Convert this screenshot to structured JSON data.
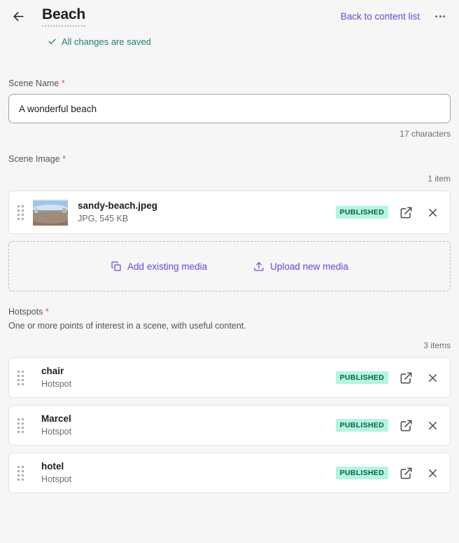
{
  "header": {
    "back_icon": "arrow-left-icon",
    "title": "Beach",
    "back_link": "Back to content list",
    "more_icon": "more-horizontal-icon"
  },
  "status": {
    "icon": "check-icon",
    "text": "All changes are saved",
    "color": "#1f7a70"
  },
  "scene_name": {
    "label": "Scene Name",
    "required_marker": "*",
    "value": "A wonderful beach",
    "placeholder": "",
    "char_count": "17 characters"
  },
  "scene_image": {
    "label": "Scene Image",
    "required_marker": "*",
    "count": "1 item",
    "items": [
      {
        "name": "sandy-beach.jpeg",
        "meta": "JPG, 545 KB",
        "status": "PUBLISHED",
        "thumb_icon": "panorama-beach-thumbnail",
        "open_icon": "open-in-new-icon",
        "remove_icon": "close-icon"
      }
    ],
    "dropzone": {
      "add_existing_label": "Add existing media",
      "add_existing_icon": "copy-icon",
      "upload_label": "Upload new media",
      "upload_icon": "upload-icon"
    }
  },
  "hotspots": {
    "label": "Hotspots",
    "required_marker": "*",
    "help": "One or more points of interest in a scene, with useful content.",
    "count": "3 items",
    "items": [
      {
        "name": "chair",
        "type": "Hotspot",
        "status": "PUBLISHED"
      },
      {
        "name": "Marcel",
        "type": "Hotspot",
        "status": "PUBLISHED"
      },
      {
        "name": "hotel",
        "type": "Hotspot",
        "status": "PUBLISHED"
      }
    ]
  },
  "colors": {
    "accent_purple": "#5b4ddb",
    "status_teal": "#1f7a70",
    "badge_bg": "#b3f5de",
    "badge_text": "#0d5c4d",
    "required_red": "#d9534f",
    "page_bg": "#f6f6f6"
  }
}
